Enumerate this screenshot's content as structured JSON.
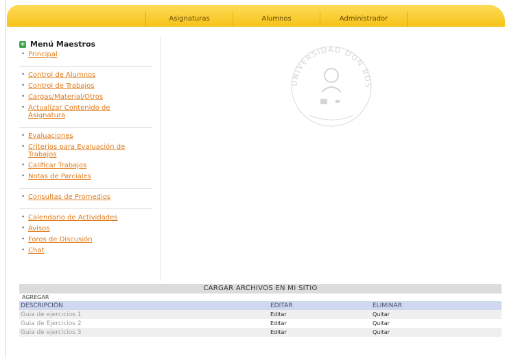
{
  "nav": {
    "items": [
      "Asignaturas",
      "Alumnos",
      "Administrador"
    ]
  },
  "sidebar": {
    "title": "Menú Maestros",
    "groups": [
      [
        "Principal"
      ],
      [
        "Control de Alumnos",
        "Control de Trabajos",
        "Cargas/Material/Otros",
        "Actualizar Contenido de Asignatura"
      ],
      [
        "Evaluaciones",
        "Criterios para Evaluación de Trabajos",
        "Calificar Trabajos",
        "Notas de Parciales"
      ],
      [
        "Consultas de Promedios"
      ],
      [
        "Calendario de Actividades",
        "Avisos",
        "Foros de Discusión",
        "Chat"
      ]
    ]
  },
  "logo": {
    "text": "UNIVERSIDAD DON BOSCO"
  },
  "files": {
    "title": "CARGAR ARCHIVOS EN MI SITIO",
    "add_label": "AGREGAR",
    "headers": [
      "DESCRIPCIÓN",
      "EDITAR",
      "ELIMINAR"
    ],
    "rows": [
      {
        "description": "Guia de ejercicios 1",
        "edit": "Editar",
        "delete": "Quitar"
      },
      {
        "description": "Guia de Ejercicios 2",
        "edit": "Editar",
        "delete": "Quitar"
      },
      {
        "description": "Guia de ejercicios 3",
        "edit": "Editar",
        "delete": "Quitar"
      }
    ]
  },
  "colors": {
    "nav_bar": "#f5c318",
    "link": "#e07a1a",
    "table_header": "#cfd8ef"
  }
}
